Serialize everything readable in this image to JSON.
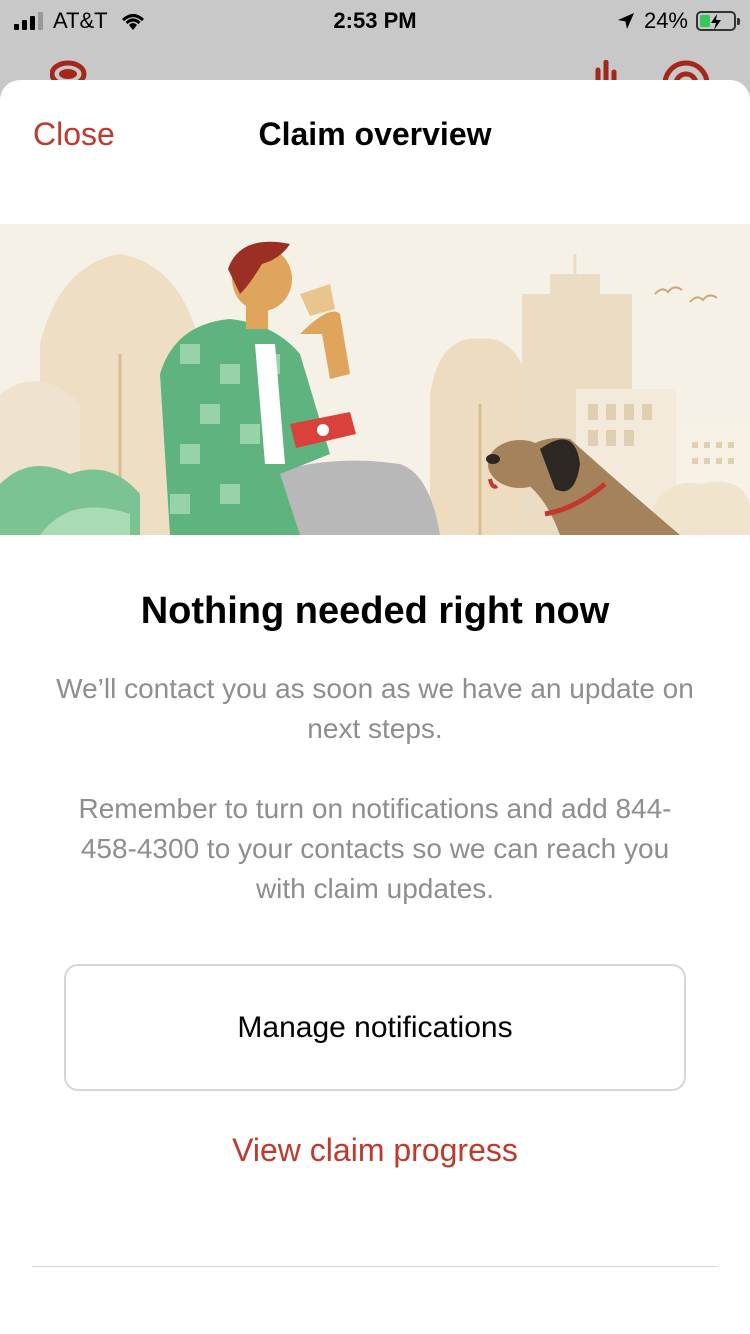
{
  "status_bar": {
    "carrier": "AT&T",
    "time": "2:53 PM",
    "battery": "24%"
  },
  "nav": {
    "close_label": "Close",
    "title": "Claim overview"
  },
  "content": {
    "heading": "Nothing needed right now",
    "paragraph1": "We’ll contact you as soon as we have an update on next steps.",
    "paragraph2": "Remember to turn on notifications and add 844-458-4300 to your contacts so we can reach you with claim updates."
  },
  "actions": {
    "manage_notifications": "Manage notifications",
    "view_claim_progress": "View claim progress"
  },
  "colors": {
    "accent": "#c0392b",
    "muted_text": "#8e8e8e",
    "illustration_bg": "#f6f1e6"
  }
}
